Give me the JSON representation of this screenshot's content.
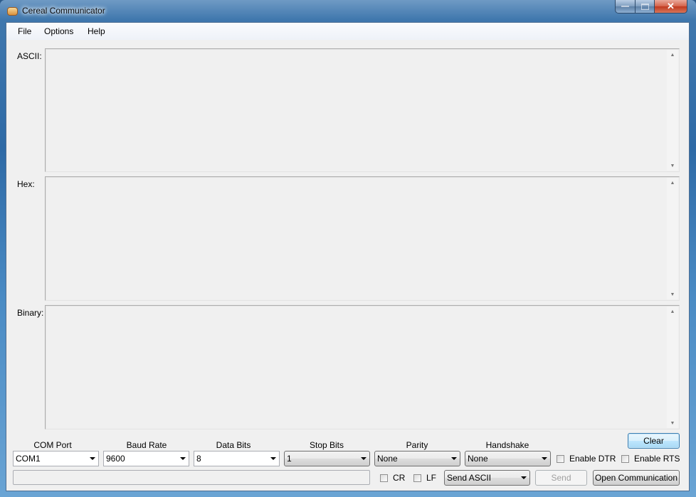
{
  "window": {
    "title": "Cereal Communicator",
    "app_icon": "cereal-bowl-icon",
    "caption_buttons": {
      "minimize": "minimize-icon",
      "maximize": "maximize-icon",
      "close": "close-icon"
    }
  },
  "menubar": {
    "items": [
      {
        "label": "File"
      },
      {
        "label": "Options"
      },
      {
        "label": "Help"
      }
    ]
  },
  "display": {
    "ascii": {
      "label": "ASCII:",
      "value": ""
    },
    "hex": {
      "label": "Hex:",
      "value": ""
    },
    "binary": {
      "label": "Binary:",
      "value": ""
    }
  },
  "settings": {
    "com_port": {
      "label": "COM Port",
      "value": "COM1"
    },
    "baud_rate": {
      "label": "Baud Rate",
      "value": "9600"
    },
    "data_bits": {
      "label": "Data Bits",
      "value": "8"
    },
    "stop_bits": {
      "label": "Stop Bits",
      "value": "1"
    },
    "parity": {
      "label": "Parity",
      "value": "None"
    },
    "handshake": {
      "label": "Handshake",
      "value": "None"
    },
    "enable_dtr": {
      "label": "Enable DTR",
      "checked": false
    },
    "enable_rts": {
      "label": "Enable RTS",
      "checked": false
    }
  },
  "send": {
    "input_value": "",
    "cr": {
      "label": "CR",
      "checked": false
    },
    "lf": {
      "label": "LF",
      "checked": false
    },
    "mode": {
      "value": "Send ASCII"
    },
    "send_label": "Send",
    "open_label": "Open Communication"
  },
  "clear_label": "Clear"
}
